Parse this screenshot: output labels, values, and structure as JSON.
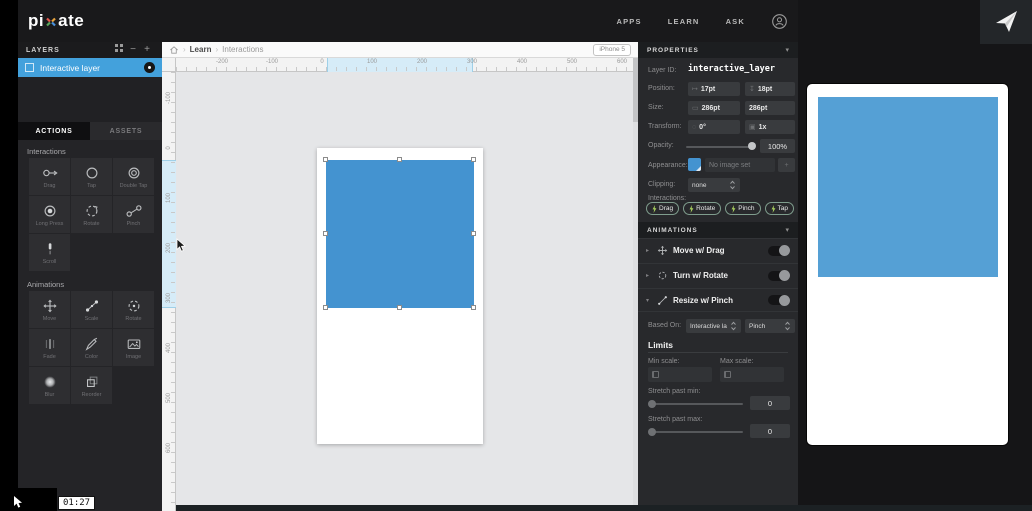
{
  "topbar": {
    "logo": "pixate",
    "nav": [
      {
        "label": "APPS"
      },
      {
        "label": "LEARN"
      },
      {
        "label": "ASK"
      }
    ]
  },
  "layers": {
    "title": "LAYERS",
    "items": [
      {
        "label": "Interactive layer"
      }
    ]
  },
  "library": {
    "tabs": {
      "actions": "ACTIONS",
      "assets": "ASSETS"
    },
    "interactions": {
      "title": "Interactions",
      "items": [
        {
          "label": "Drag"
        },
        {
          "label": "Tap"
        },
        {
          "label": "Double Tap"
        },
        {
          "label": "Long Press"
        },
        {
          "label": "Rotate"
        },
        {
          "label": "Pinch"
        },
        {
          "label": "Scroll"
        }
      ]
    },
    "animations": {
      "title": "Animations",
      "items": [
        {
          "label": "Move"
        },
        {
          "label": "Scale"
        },
        {
          "label": "Rotate"
        },
        {
          "label": "Fade"
        },
        {
          "label": "Color"
        },
        {
          "label": "Image"
        },
        {
          "label": "Blur"
        },
        {
          "label": "Reorder"
        }
      ]
    }
  },
  "canvas": {
    "breadcrumb": {
      "separator": "›",
      "items": [
        "Learn",
        "Interactions"
      ]
    },
    "device": "iPhone 5",
    "h_ruler": [
      "-200",
      "-100",
      "0",
      "100",
      "200",
      "300",
      "400",
      "500",
      "600"
    ],
    "v_ruler": [
      "-100",
      "0",
      "100",
      "200",
      "300",
      "400",
      "500",
      "600"
    ]
  },
  "properties": {
    "title": "PROPERTIES",
    "layer_id": {
      "label": "Layer ID:",
      "value": "interactive_layer"
    },
    "position": {
      "label": "Position:",
      "x": "17pt",
      "y": "18pt"
    },
    "size": {
      "label": "Size:",
      "w": "286pt",
      "h": "286pt"
    },
    "transform": {
      "label": "Transform:",
      "rotation": "0°",
      "scale": "1x"
    },
    "opacity": {
      "label": "Opacity:",
      "value": "100%"
    },
    "appearance": {
      "label": "Appearance:",
      "value": "No image set"
    },
    "clipping": {
      "label": "Clipping:",
      "value": "none"
    },
    "interactions": {
      "label": "Interactions:",
      "tags": [
        {
          "label": "Drag"
        },
        {
          "label": "Rotate"
        },
        {
          "label": "Pinch"
        },
        {
          "label": "Tap"
        }
      ]
    }
  },
  "animations_panel": {
    "title": "ANIMATIONS",
    "rows": [
      {
        "label": "Move w/ Drag"
      },
      {
        "label": "Turn w/ Rotate"
      },
      {
        "label": "Resize w/ Pinch"
      }
    ],
    "resize": {
      "based_on": {
        "label": "Based On:",
        "layer": "Interactive la",
        "event": "Pinch"
      },
      "limits_title": "Limits",
      "min_scale_label": "Min scale:",
      "max_scale_label": "Max scale:",
      "stretch_min": {
        "label": "Stretch past min:",
        "value": "0"
      },
      "stretch_max": {
        "label": "Stretch past max:",
        "value": "0"
      }
    }
  },
  "video": {
    "timestamp": "01:27"
  },
  "colors": {
    "square_blue": "#4493d0",
    "selection_blue": "#43a1dc",
    "ruler_highlight": "#d6ecf8",
    "pill_border": "#7f9d8d",
    "bolt_green": "#a8cf5e"
  }
}
